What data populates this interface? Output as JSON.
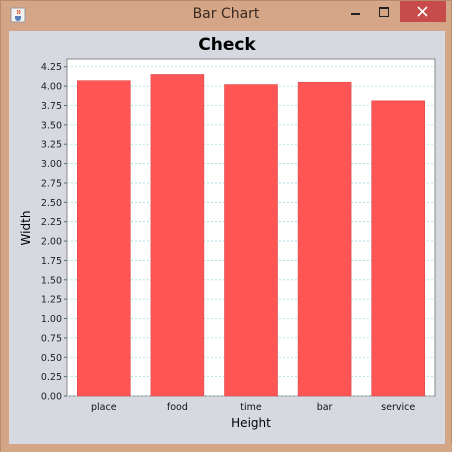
{
  "window": {
    "title": "Bar Chart",
    "icon": "java-cup-icon",
    "buttons": {
      "minimize": "minimize-icon",
      "maximize": "maximize-icon",
      "close": "close-icon"
    }
  },
  "colors": {
    "frame": "#d4a587",
    "client_bg": "#d6d9e0",
    "plot_bg": "#ffffff",
    "bar": "#ff5555",
    "grid": "#9adde0",
    "close_button": "#c74b4b"
  },
  "chart_data": {
    "type": "bar",
    "title": "Check",
    "xlabel": "Height",
    "ylabel": "Width",
    "categories": [
      "place",
      "food",
      "time",
      "bar",
      "service"
    ],
    "values": [
      4.07,
      4.15,
      4.02,
      4.05,
      3.81
    ],
    "ylim": [
      0,
      4.35
    ],
    "yticks": [
      "0.00",
      "0.25",
      "0.50",
      "0.75",
      "1.00",
      "1.25",
      "1.50",
      "1.75",
      "2.00",
      "2.25",
      "2.50",
      "2.75",
      "3.00",
      "3.25",
      "3.50",
      "3.75",
      "4.00",
      "4.25"
    ],
    "grid": true,
    "legend": "none"
  }
}
